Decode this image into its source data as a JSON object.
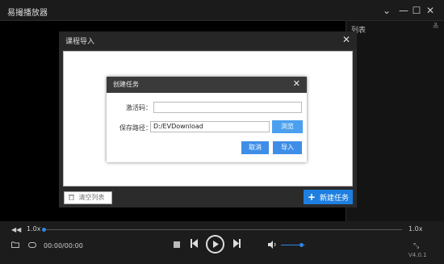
{
  "app": {
    "title": "易撮播放器"
  },
  "window_controls": {
    "dropdown": "⌄",
    "minimize": "—",
    "maximize": "☐",
    "close": "✕"
  },
  "playlist": {
    "title": "列表",
    "collapse_glyph": "≚"
  },
  "course_dialog": {
    "title": "课程导入",
    "close_glyph": "✕",
    "clear_button": "清空列表",
    "new_task_button": "新建任务"
  },
  "task_dialog": {
    "title": "创建任务",
    "close_glyph": "✕",
    "activation_label": "激活码：",
    "activation_value": "",
    "save_path_label": "保存路径：",
    "save_path_value": "D:/EVDownload",
    "browse_button": "浏览",
    "cancel_button": "取消",
    "import_button": "导入"
  },
  "controls": {
    "speed_left": "1.0x",
    "speed_right": "1.0x",
    "time": "00:00/00:00",
    "progress_fraction": 0.0,
    "volume_fraction": 0.85,
    "version": "V4.0.1"
  },
  "colors": {
    "accent": "#1e7fe0",
    "button_blue": "#3e8ee8"
  }
}
